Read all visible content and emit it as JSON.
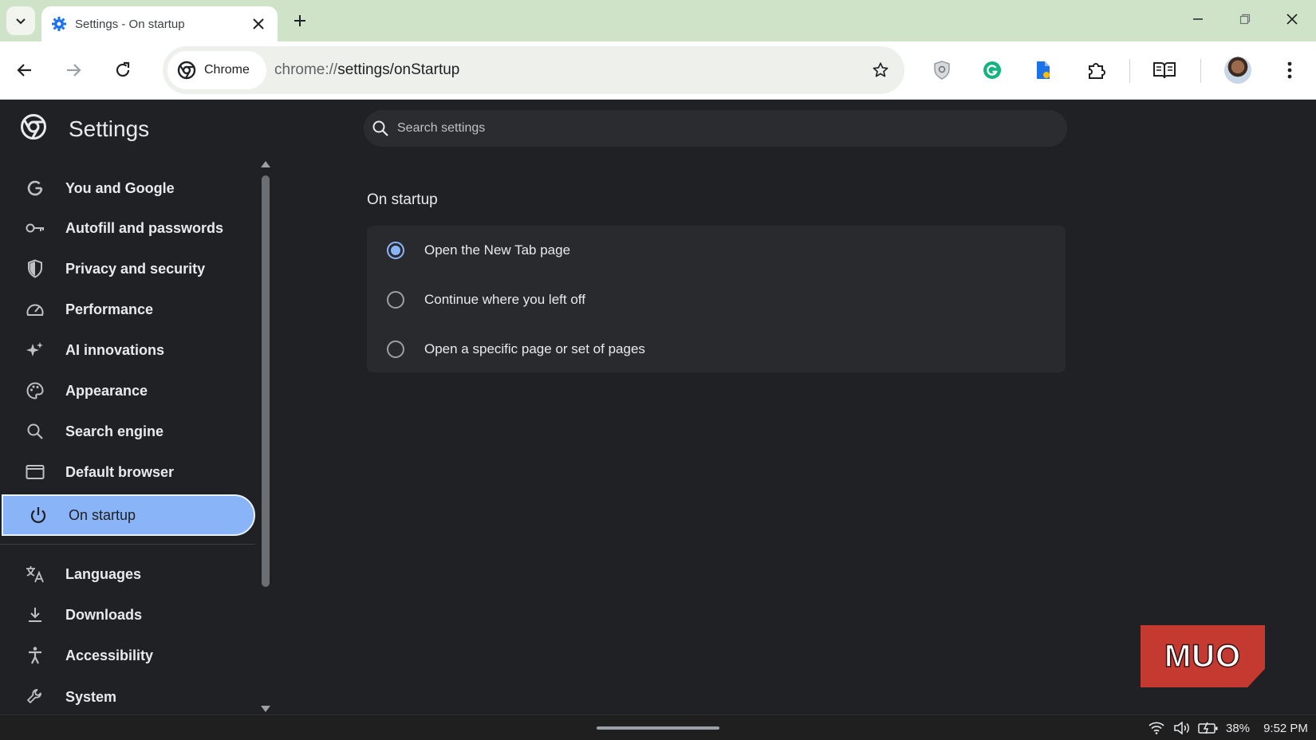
{
  "browser": {
    "tab": {
      "title": "Settings - On startup"
    },
    "omnibox": {
      "site_chip_label": "Chrome",
      "url_scheme": "chrome://",
      "url_path": "settings/onStartup"
    }
  },
  "settings": {
    "title": "Settings",
    "search_placeholder": "Search settings",
    "nav": [
      {
        "label": "You and Google",
        "icon": "google-g-icon"
      },
      {
        "label": "Autofill and passwords",
        "icon": "key-icon"
      },
      {
        "label": "Privacy and security",
        "icon": "shield-icon"
      },
      {
        "label": "Performance",
        "icon": "speedometer-icon"
      },
      {
        "label": "AI innovations",
        "icon": "sparkle-icon"
      },
      {
        "label": "Appearance",
        "icon": "palette-icon"
      },
      {
        "label": "Search engine",
        "icon": "search-icon"
      },
      {
        "label": "Default browser",
        "icon": "browser-window-icon"
      },
      {
        "label": "On startup",
        "icon": "power-icon",
        "active": true
      },
      {
        "label": "Languages",
        "icon": "translate-icon"
      },
      {
        "label": "Downloads",
        "icon": "download-icon"
      },
      {
        "label": "Accessibility",
        "icon": "accessibility-icon"
      },
      {
        "label": "System",
        "icon": "wrench-icon"
      }
    ],
    "section_title": "On startup",
    "options": [
      {
        "label": "Open the New Tab page",
        "checked": true
      },
      {
        "label": "Continue where you left off",
        "checked": false
      },
      {
        "label": "Open a specific page or set of pages",
        "checked": false
      }
    ]
  },
  "watermark": {
    "text": "MUO"
  },
  "taskbar": {
    "battery": "38%",
    "time": "9:52 PM"
  },
  "colors": {
    "accent": "#8ab4f8",
    "page_background": "#202124",
    "card_background": "#292a2d",
    "tabstrip": "#cfe3c9",
    "watermark": "#c43a31"
  }
}
